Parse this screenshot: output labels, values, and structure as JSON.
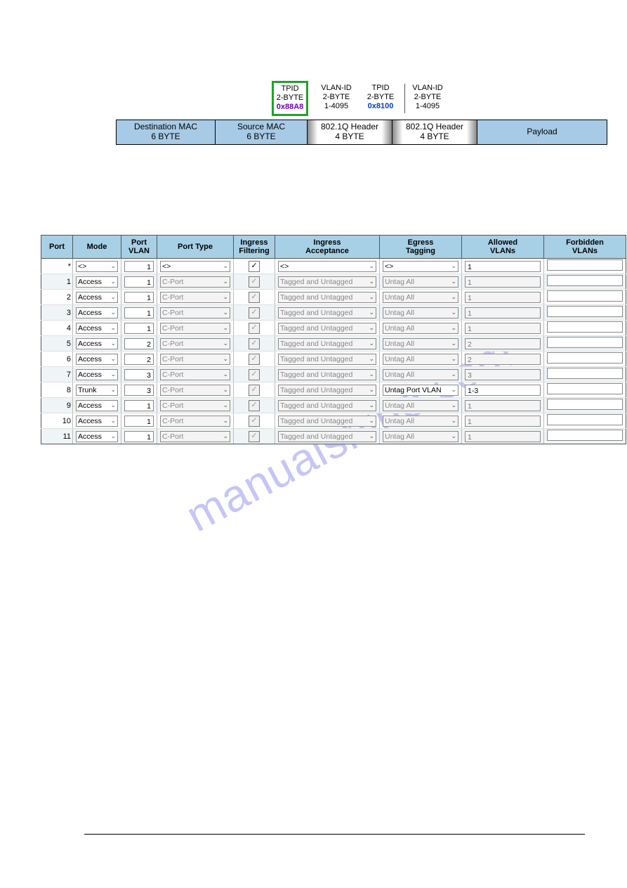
{
  "watermark": "manualshine.com",
  "frame": {
    "header_tpid1": {
      "l1": "TPID",
      "l2": "2-BYTE",
      "l3": "0x88A8"
    },
    "header_vlanid1": {
      "l1": "VLAN-ID",
      "l2": "2-BYTE",
      "l3": "1-4095"
    },
    "header_tpid2": {
      "l1": "TPID",
      "l2": "2-BYTE",
      "l3": "0x8100"
    },
    "header_vlanid2": {
      "l1": "VLAN-ID",
      "l2": "2-BYTE",
      "l3": "1-4095"
    },
    "segments": {
      "dest": {
        "l1": "Destination MAC",
        "l2": "6 BYTE"
      },
      "src": {
        "l1": "Source MAC",
        "l2": "6 BYTE"
      },
      "hdr1": {
        "l1": "802.1Q Header",
        "l2": "4 BYTE"
      },
      "hdr2": {
        "l1": "802.1Q Header",
        "l2": "4 BYTE"
      },
      "payload": "Payload"
    }
  },
  "table": {
    "headers": {
      "port": "Port",
      "mode": "Mode",
      "pvlan_l1": "Port",
      "pvlan_l2": "VLAN",
      "ptype": "Port Type",
      "ifilt_l1": "Ingress",
      "ifilt_l2": "Filtering",
      "iacc_l1": "Ingress",
      "iacc_l2": "Acceptance",
      "etag_l1": "Egress",
      "etag_l2": "Tagging",
      "allow_l1": "Allowed",
      "allow_l2": "VLANs",
      "forb_l1": "Forbidden",
      "forb_l2": "VLANs"
    },
    "rows": [
      {
        "port": "*",
        "mode": "<>",
        "pvlan": "1",
        "ptype": "<>",
        "ptype_dis": false,
        "iacc": "<>",
        "iacc_dis": false,
        "etag": "<>",
        "etag_dis": false,
        "allow": "1",
        "allow_dis": false,
        "forb": "",
        "ifilt_dis": false
      },
      {
        "port": "1",
        "mode": "Access",
        "pvlan": "1",
        "ptype": "C-Port",
        "ptype_dis": true,
        "iacc": "Tagged and Untagged",
        "iacc_dis": true,
        "etag": "Untag All",
        "etag_dis": true,
        "allow": "1",
        "allow_dis": true,
        "forb": "",
        "ifilt_dis": true
      },
      {
        "port": "2",
        "mode": "Access",
        "pvlan": "1",
        "ptype": "C-Port",
        "ptype_dis": true,
        "iacc": "Tagged and Untagged",
        "iacc_dis": true,
        "etag": "Untag All",
        "etag_dis": true,
        "allow": "1",
        "allow_dis": true,
        "forb": "",
        "ifilt_dis": true
      },
      {
        "port": "3",
        "mode": "Access",
        "pvlan": "1",
        "ptype": "C-Port",
        "ptype_dis": true,
        "iacc": "Tagged and Untagged",
        "iacc_dis": true,
        "etag": "Untag All",
        "etag_dis": true,
        "allow": "1",
        "allow_dis": true,
        "forb": "",
        "ifilt_dis": true
      },
      {
        "port": "4",
        "mode": "Access",
        "pvlan": "1",
        "ptype": "C-Port",
        "ptype_dis": true,
        "iacc": "Tagged and Untagged",
        "iacc_dis": true,
        "etag": "Untag All",
        "etag_dis": true,
        "allow": "1",
        "allow_dis": true,
        "forb": "",
        "ifilt_dis": true
      },
      {
        "port": "5",
        "mode": "Access",
        "pvlan": "2",
        "ptype": "C-Port",
        "ptype_dis": true,
        "iacc": "Tagged and Untagged",
        "iacc_dis": true,
        "etag": "Untag All",
        "etag_dis": true,
        "allow": "2",
        "allow_dis": true,
        "forb": "",
        "ifilt_dis": true
      },
      {
        "port": "6",
        "mode": "Access",
        "pvlan": "2",
        "ptype": "C-Port",
        "ptype_dis": true,
        "iacc": "Tagged and Untagged",
        "iacc_dis": true,
        "etag": "Untag All",
        "etag_dis": true,
        "allow": "2",
        "allow_dis": true,
        "forb": "",
        "ifilt_dis": true
      },
      {
        "port": "7",
        "mode": "Access",
        "pvlan": "3",
        "ptype": "C-Port",
        "ptype_dis": true,
        "iacc": "Tagged and Untagged",
        "iacc_dis": true,
        "etag": "Untag All",
        "etag_dis": true,
        "allow": "3",
        "allow_dis": true,
        "forb": "",
        "ifilt_dis": true
      },
      {
        "port": "8",
        "mode": "Trunk",
        "pvlan": "3",
        "ptype": "C-Port",
        "ptype_dis": true,
        "iacc": "Tagged and Untagged",
        "iacc_dis": true,
        "etag": "Untag Port VLAN",
        "etag_dis": false,
        "allow": "1-3",
        "allow_dis": false,
        "forb": "",
        "ifilt_dis": true
      },
      {
        "port": "9",
        "mode": "Access",
        "pvlan": "1",
        "ptype": "C-Port",
        "ptype_dis": true,
        "iacc": "Tagged and Untagged",
        "iacc_dis": true,
        "etag": "Untag All",
        "etag_dis": true,
        "allow": "1",
        "allow_dis": true,
        "forb": "",
        "ifilt_dis": true
      },
      {
        "port": "10",
        "mode": "Access",
        "pvlan": "1",
        "ptype": "C-Port",
        "ptype_dis": true,
        "iacc": "Tagged and Untagged",
        "iacc_dis": true,
        "etag": "Untag All",
        "etag_dis": true,
        "allow": "1",
        "allow_dis": true,
        "forb": "",
        "ifilt_dis": true
      },
      {
        "port": "11",
        "mode": "Access",
        "pvlan": "1",
        "ptype": "C-Port",
        "ptype_dis": true,
        "iacc": "Tagged and Untagged",
        "iacc_dis": true,
        "etag": "Untag All",
        "etag_dis": true,
        "allow": "1",
        "allow_dis": true,
        "forb": "",
        "ifilt_dis": true
      }
    ]
  }
}
